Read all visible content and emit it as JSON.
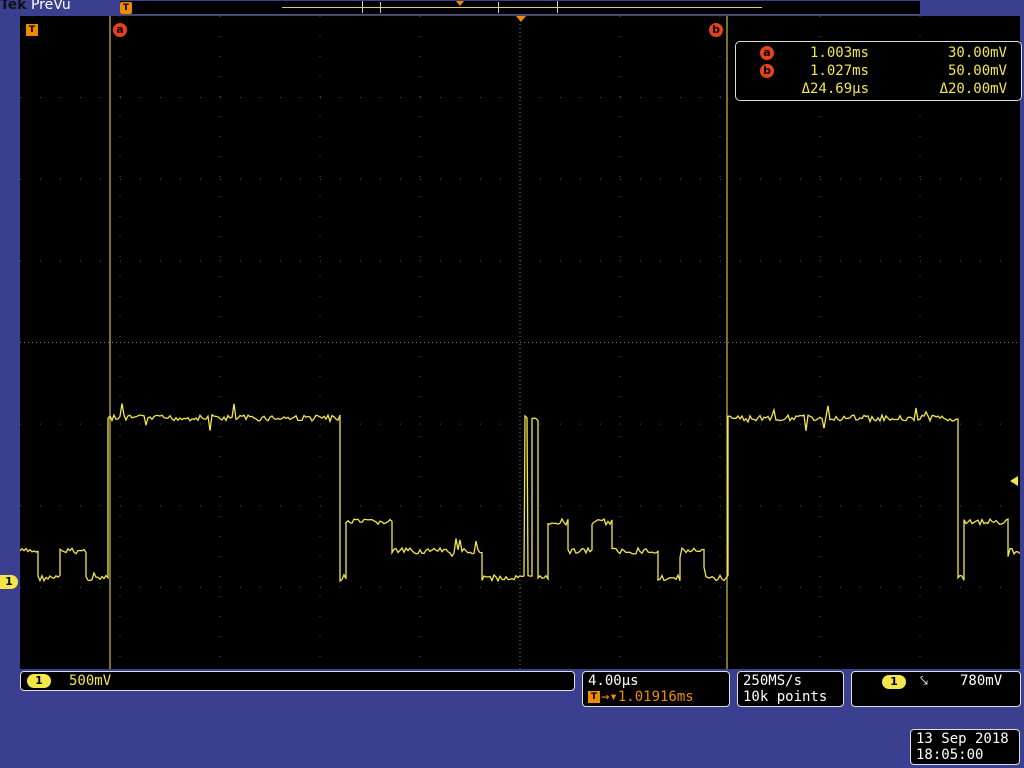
{
  "app": {
    "brand_tek": "Tek",
    "brand_mode": "PreVu"
  },
  "colors": {
    "background": "#3b3f8f",
    "graticule_bg": "#000000",
    "trace": "#f3e64a",
    "cursor": "#f3e64a",
    "cursor_label": "#e8421a",
    "trigger": "#f08a00"
  },
  "icons": {
    "trigger_position": "T-flag-icon",
    "cursor_a": "a-cursor-icon",
    "cursor_b": "b-cursor-icon",
    "falling_edge": "falling-edge-icon"
  },
  "cursors": {
    "a_label": "a",
    "b_label": "b",
    "rows": [
      {
        "tag": "a",
        "time": "1.003ms",
        "value": "30.00mV"
      },
      {
        "tag": "b",
        "time": "1.027ms",
        "value": "50.00mV"
      },
      {
        "tag": "",
        "time": "Δ24.69µs",
        "value": "Δ20.00mV"
      }
    ]
  },
  "trigger": {
    "marker": "T"
  },
  "channel": {
    "number": "1",
    "scale": "500mV"
  },
  "horizontal": {
    "scale": "4.00µs",
    "trigger_icon": "T",
    "delay": "→▾1.01916ms"
  },
  "acquisition": {
    "rate": "250MS/s",
    "points": "10k points"
  },
  "trigger_settings": {
    "channel": "1",
    "slope_symbol": "⤥",
    "level": "780mV"
  },
  "datetime": {
    "date": "13 Sep  2018",
    "time": "18:05:00"
  },
  "waveform": {
    "description": "Channel 1 digital-like waveform with levels",
    "segments": [
      {
        "level": "mid_low",
        "length": 20
      },
      {
        "level": "high",
        "length": 230
      },
      {
        "level": "low_mid",
        "length": 190
      },
      {
        "level": "high",
        "length": 230
      }
    ]
  }
}
